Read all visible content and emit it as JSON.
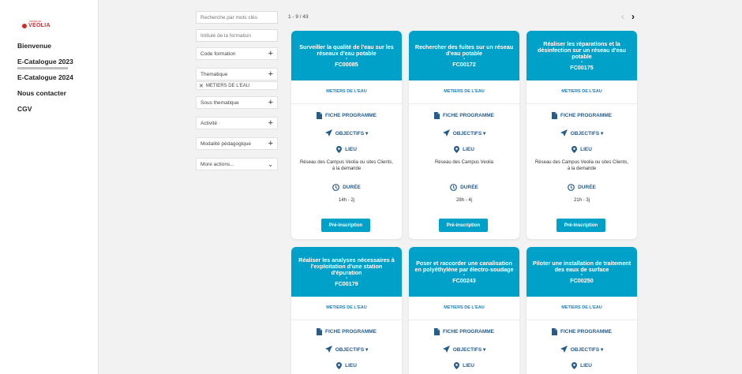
{
  "logo": {
    "small": "campus",
    "main": "VEOLIA"
  },
  "nav": [
    {
      "label": "Bienvenue"
    },
    {
      "label": "E-Catalogue 2023"
    },
    {
      "label": "E-Catalogue 2024"
    },
    {
      "label": "Nous contacter"
    },
    {
      "label": "CGV"
    }
  ],
  "filters": {
    "keyword_placeholder": "Recherche par mots clés",
    "title_placeholder": "Intitulé de la formation",
    "code": "Code formation",
    "thematique": "Thematique",
    "chip": "METIERS DE L'EAU",
    "sous_thematique": "Sous thematique",
    "activite": "Activité",
    "modalite": "Modalité pédagogique",
    "more": "More actions..."
  },
  "pager": {
    "range": "1 - 9 / 43",
    "prev": "‹",
    "next": "›"
  },
  "labels": {
    "fiche": "FICHE PROGRAMME",
    "objectifs": "OBJECTIFS ▾",
    "lieu": "LIEU",
    "duree": "DURÉE",
    "inscription": "Pré-inscription",
    "dash": "-",
    "plus": "+",
    "chevron": "⌄",
    "close": "✕"
  },
  "colors": {
    "accent": "#00a1c9",
    "link": "#255c8a",
    "brand": "#d12c2c"
  },
  "cards": [
    {
      "title": "Surveiller la qualité de l'eau sur les réseaux d'eau potable",
      "code": "FC00085",
      "category": "METIERS DE L'EAU",
      "lieu": "Réseau des Campus Veolia ou sites Clients, à la demande",
      "duree": "14h - 2j"
    },
    {
      "title": "Rechercher des fuites sur un réseau d'eau potable",
      "code": "FC00172",
      "category": "METIERS DE L'EAU",
      "lieu": "Réseau des Campus Veolia",
      "duree": "28h - 4j"
    },
    {
      "title": "Réaliser les réparations et la désinfection sur un réseau d'eau potable",
      "code": "FC00175",
      "category": "METIERS DE L'EAU",
      "lieu": "Réseau des Campus Veolia ou sites Clients, à la demande",
      "duree": "21h - 3j"
    },
    {
      "title": "Réaliser les analyses nécessaires à l'exploitation d'une station d'épuration",
      "code": "FC00179",
      "category": "METIERS DE L'EAU"
    },
    {
      "title": "Poser et raccorder une canalisation en polyéthylène par électro-soudage",
      "code": "FC00243",
      "category": "METIERS DE L'EAU"
    },
    {
      "title": "Piloter une installation de traitement des eaux de surface",
      "code": "FC00250",
      "category": "METIERS DE L'EAU"
    }
  ]
}
